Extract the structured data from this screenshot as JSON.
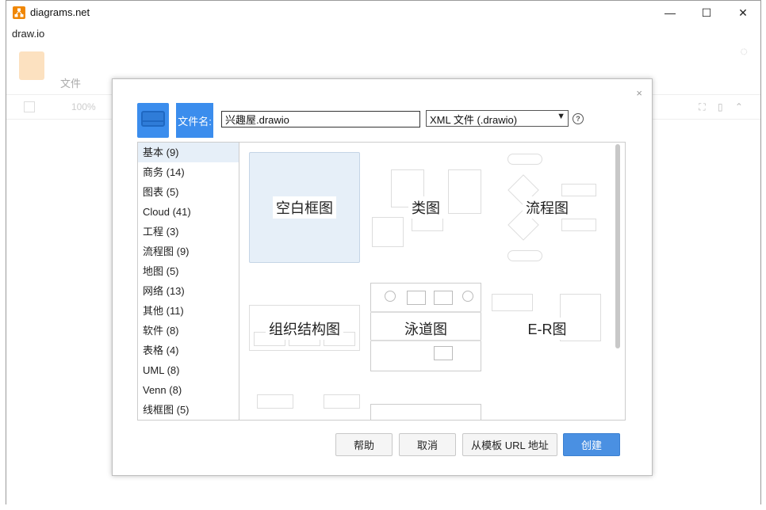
{
  "window": {
    "title": "diagrams.net",
    "menu_label": "draw.io",
    "controls": {
      "minimize": "—",
      "maximize": "☐",
      "close": "✕"
    }
  },
  "app_background": {
    "file_menu": "文件",
    "zoom": "100%"
  },
  "dialog": {
    "close_glyph": "×",
    "filename_label": "文件名:",
    "filename_value": "兴趣屋.drawio",
    "format_selected": "XML 文件 (.drawio)",
    "help_glyph": "?",
    "categories": [
      "基本 (9)",
      "商务 (14)",
      "图表 (5)",
      "Cloud (41)",
      "工程 (3)",
      "流程图 (9)",
      "地图 (5)",
      "网络 (13)",
      "其他 (11)",
      "软件 (8)",
      "表格 (4)",
      "UML (8)",
      "Venn (8)",
      "线框图 (5)"
    ],
    "selected_category_index": 0,
    "templates": [
      {
        "label": "空白框图",
        "selected": true
      },
      {
        "label": "类图",
        "selected": false
      },
      {
        "label": "流程图",
        "selected": false
      },
      {
        "label": "组织结构图",
        "selected": false
      },
      {
        "label": "泳道图",
        "selected": false
      },
      {
        "label": "E-R图",
        "selected": false
      }
    ],
    "buttons": {
      "help": "帮助",
      "cancel": "取消",
      "from_url": "从模板 URL 地址",
      "create": "创建"
    }
  },
  "colors": {
    "accent": "#4a90e2",
    "header_blue": "#3b8ded",
    "selection": "#e6eff8",
    "brand_orange": "#f08705"
  }
}
